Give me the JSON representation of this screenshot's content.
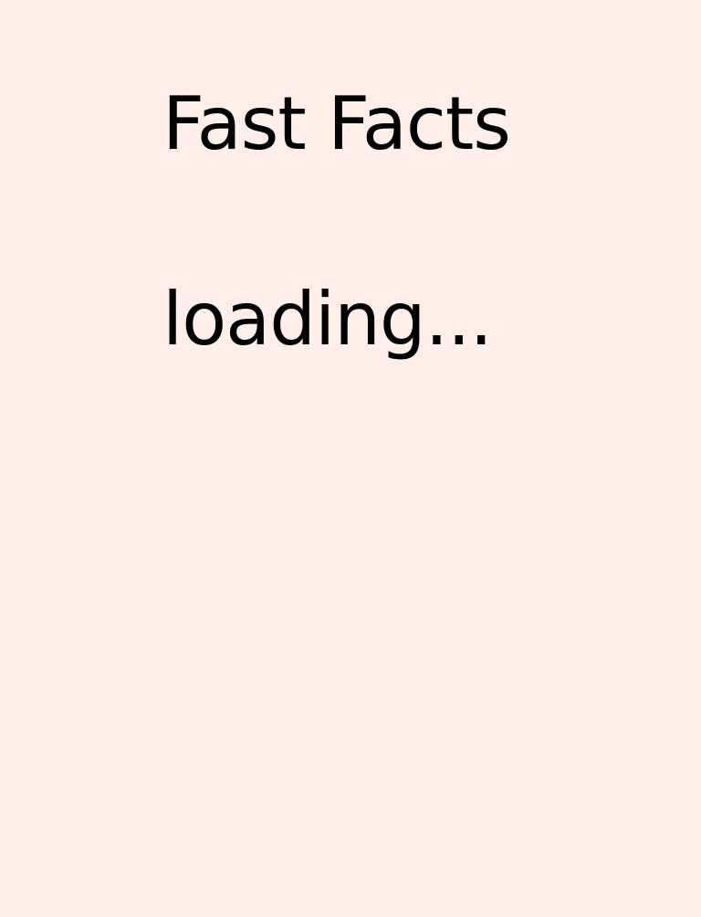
{
  "page": {
    "title": "Fast Facts",
    "status": "loading..."
  },
  "colors": {
    "background": "#FFEFE8",
    "text": "#000000"
  }
}
